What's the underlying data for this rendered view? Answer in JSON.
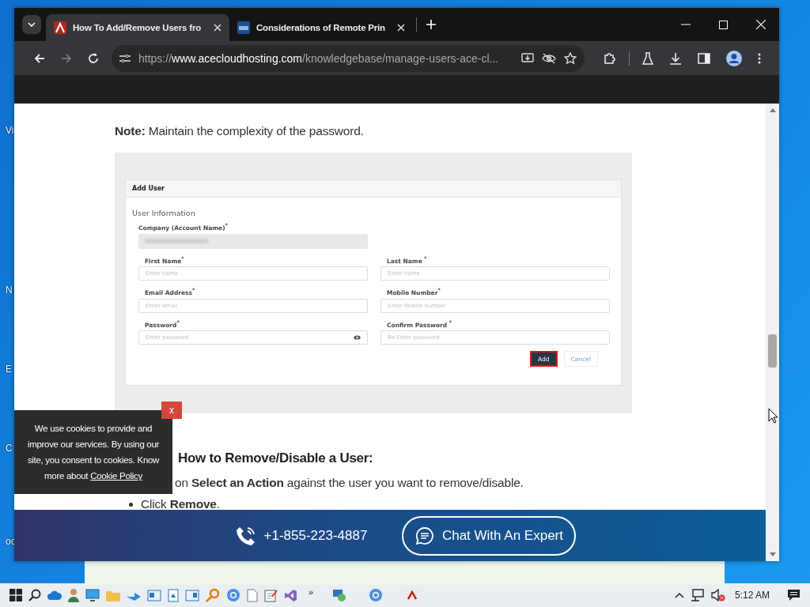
{
  "desktop_icons": [
    {
      "label": "Vi"
    },
    {
      "label": "N"
    },
    {
      "label": "E"
    },
    {
      "label": "C"
    },
    {
      "label": "oc"
    }
  ],
  "browser": {
    "tabs": [
      {
        "title": "How To Add/Remove Users fro",
        "selected": true
      },
      {
        "title": "Considerations of Remote Prin",
        "selected": false
      }
    ],
    "address": {
      "scheme": "https://",
      "host": "www.acecloudhosting.com",
      "path": "/knowledgebase/manage-users-ace-cl..."
    }
  },
  "article": {
    "note": "**Note:** Maintain the complexity of the password.",
    "screenshot": {
      "title": "Add User",
      "section": "User Information",
      "company_label": "Company (Account Name)$^{*}$",
      "fields": [
        {
          "label": "First Name$^{*}$",
          "placeholder": "Enter name",
          "reveal": false
        },
        {
          "label": "Last Name $^{*}$",
          "placeholder": "Enter name",
          "reveal": false
        },
        {
          "label": "Email Address$^{*}$",
          "placeholder": "Enter email",
          "reveal": false
        },
        {
          "label": "Mobile Number$^{*}$",
          "placeholder": "Enter Mobile number",
          "reveal": false
        },
        {
          "label": "Password$^{*}$",
          "placeholder": "Enter password",
          "reveal": true
        },
        {
          "label": "Confirm Password $^{*}$",
          "placeholder": "Re-Enter password",
          "reveal": false
        }
      ],
      "buttons": [
        {
          "label": "Add",
          "highlighted": true
        },
        {
          "label": "Cancel",
          "highlighted": false
        }
      ]
    },
    "step_heading": "How to Remove/Disable a User:",
    "steps": [
      {
        "kind": "continuation",
        "text": "on **Select an Action** against the user you want to remove/disable."
      },
      {
        "kind": "bullet",
        "text": "Click **Remove**."
      }
    ]
  },
  "cookie": {
    "text": "We use cookies to provide and improve our services. By using our site, you consent to cookies. Know more about",
    "link": "Cookie Policy",
    "close": "x"
  },
  "chat_bar": {
    "phone": "+1-855-223-4887",
    "button": "Chat With An Expert"
  },
  "taskbar": {
    "overflow": "»",
    "time": "5:12 AM"
  }
}
